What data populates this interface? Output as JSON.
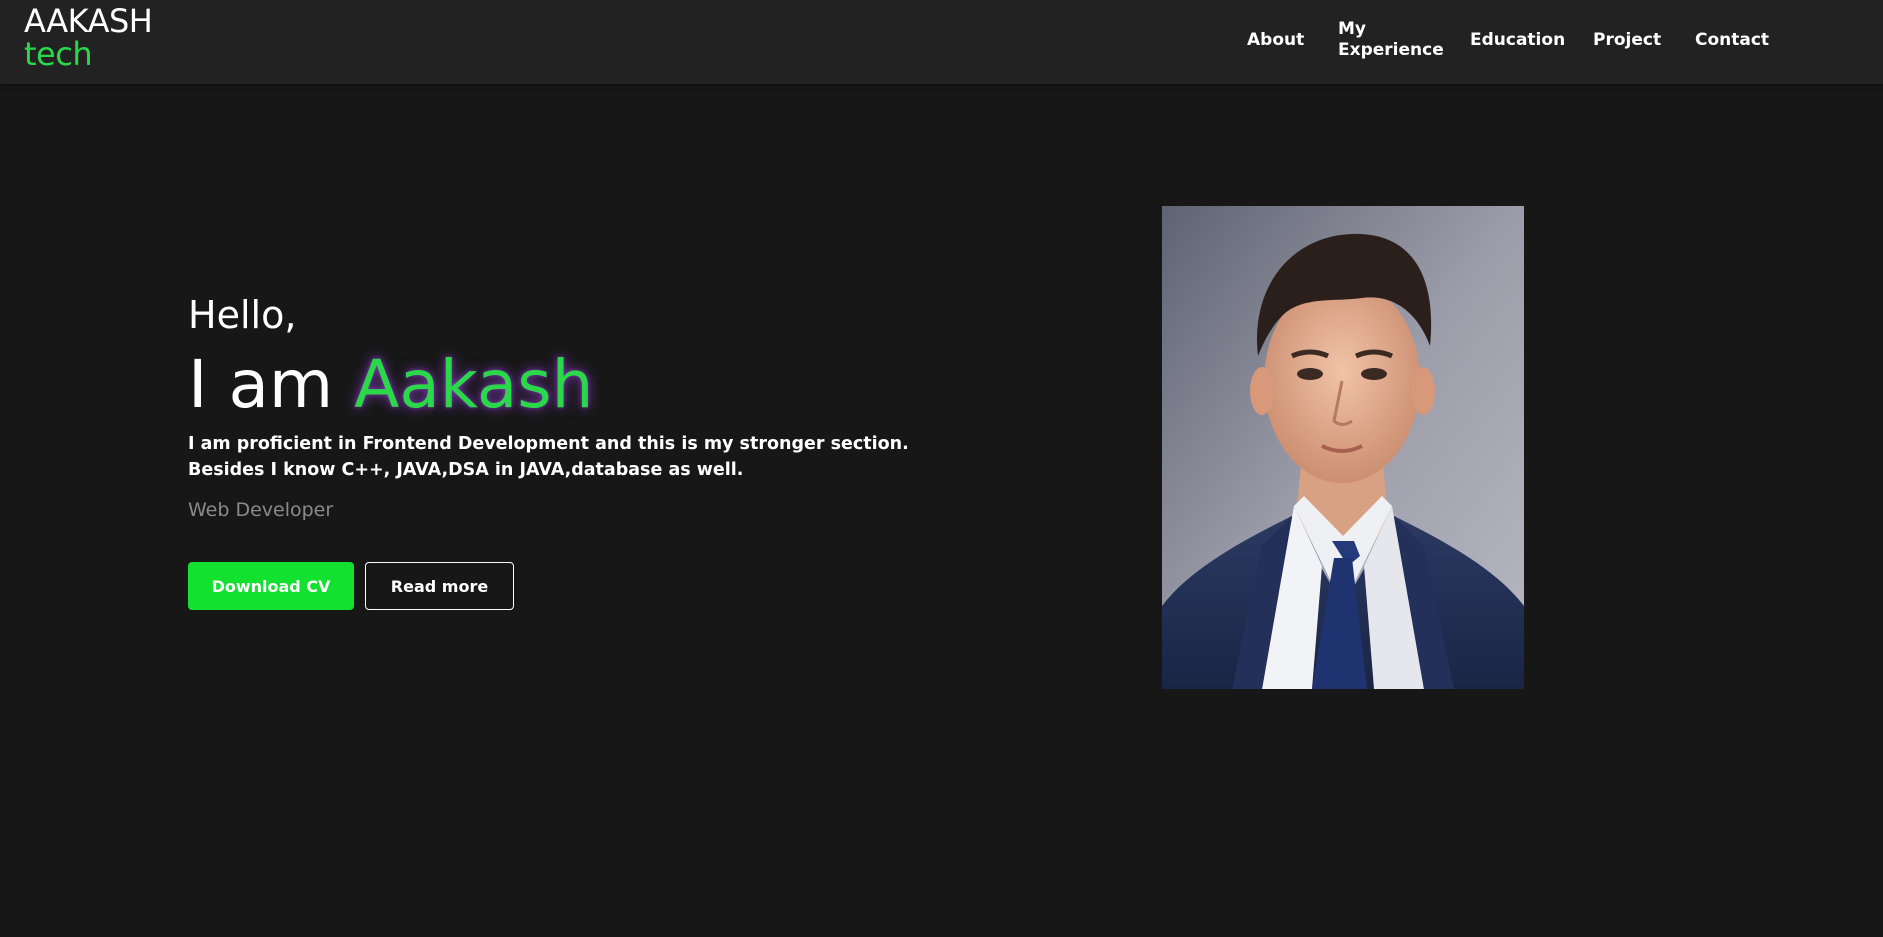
{
  "brand": {
    "line1": "AAKASH",
    "line2": "tech",
    "accent_color": "#2bd84a"
  },
  "nav": {
    "about": "About",
    "experience_line1": "My",
    "experience_line2": "Experience",
    "education": "Education",
    "project": "Project",
    "contact": "Contact"
  },
  "hero": {
    "greeting": "Hello,",
    "intro_prefix": "I am",
    "name": "Aakash",
    "description_line1": "I am proficient in Frontend Development and this is my stronger section.",
    "description_line2": "Besides I know C++, JAVA,DSA in JAVA,database as well.",
    "role": "Web Developer",
    "download_label": "Download CV",
    "read_more_label": "Read more",
    "primary_button_color": "#12e22f"
  },
  "portrait": {
    "icon": "profile-photo"
  }
}
